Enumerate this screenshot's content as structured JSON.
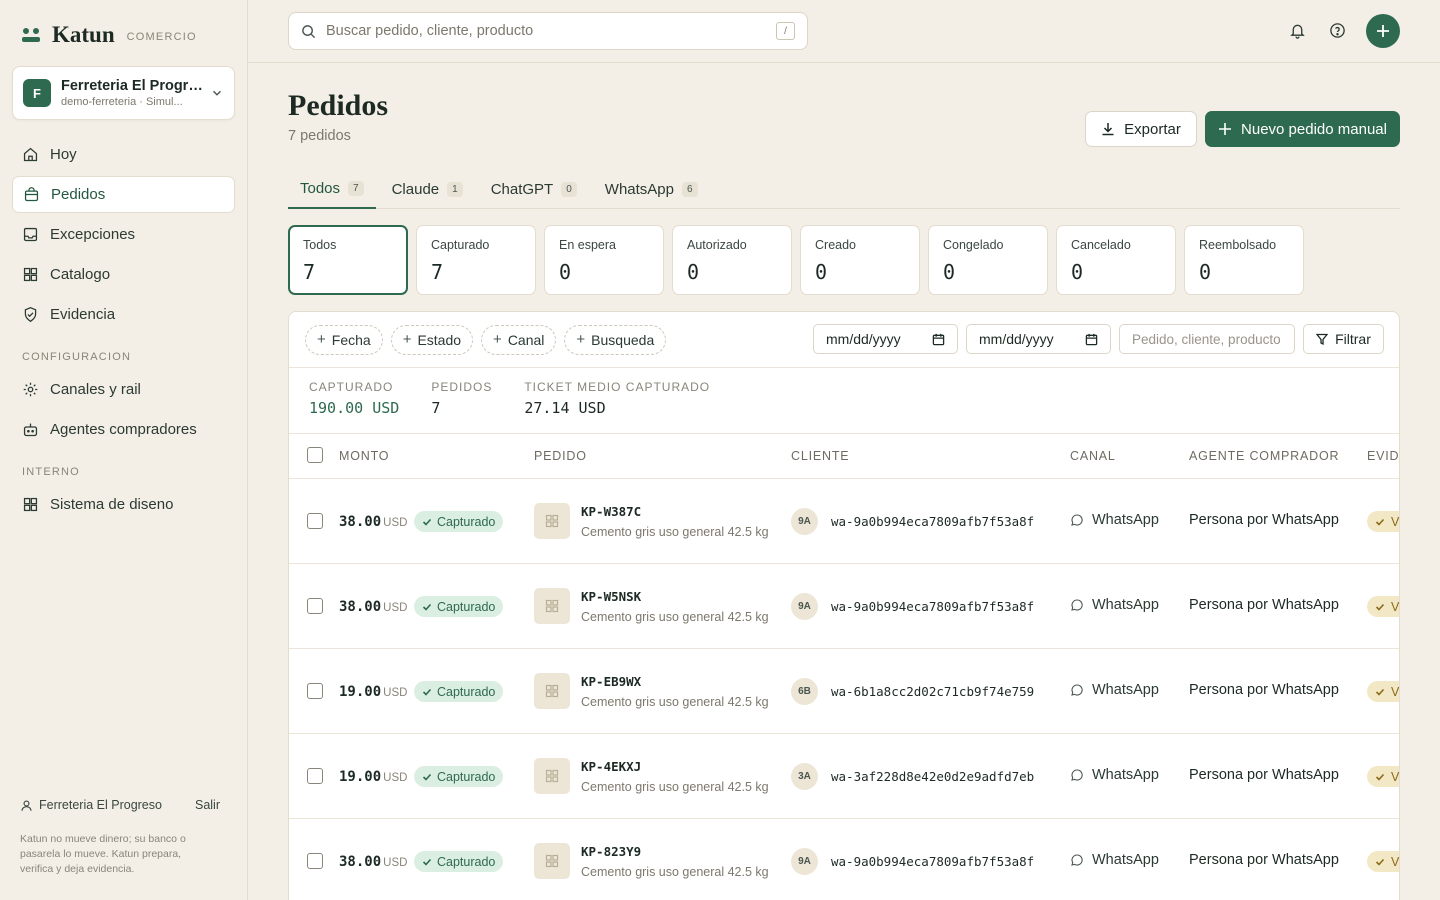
{
  "brand": {
    "name": "Katun",
    "sub": "COMERCIO"
  },
  "store": {
    "initial": "F",
    "name": "Ferreteria El Progre...",
    "meta": "demo-ferreteria · Simul..."
  },
  "nav": {
    "main": [
      {
        "label": "Hoy"
      },
      {
        "label": "Pedidos"
      },
      {
        "label": "Excepciones"
      },
      {
        "label": "Catalogo"
      },
      {
        "label": "Evidencia"
      }
    ],
    "config_title": "CONFIGURACION",
    "config": [
      {
        "label": "Canales y rail"
      },
      {
        "label": "Agentes compradores"
      }
    ],
    "internal_title": "INTERNO",
    "internal": [
      {
        "label": "Sistema de diseno"
      }
    ]
  },
  "footer": {
    "user": "Ferreteria El Progreso",
    "logout": "Salir",
    "note": "Katun no mueve dinero; su banco o pasarela lo mueve. Katun prepara, verifica y deja evidencia."
  },
  "search": {
    "placeholder": "Buscar pedido, cliente, producto",
    "shortcut": "/"
  },
  "page": {
    "title": "Pedidos",
    "count": "7 pedidos",
    "export_label": "Exportar",
    "new_label": "Nuevo pedido manual"
  },
  "tabs": [
    {
      "label": "Todos",
      "count": "7"
    },
    {
      "label": "Claude",
      "count": "1"
    },
    {
      "label": "ChatGPT",
      "count": "0"
    },
    {
      "label": "WhatsApp",
      "count": "6"
    }
  ],
  "status_cards": [
    {
      "label": "Todos",
      "value": "7"
    },
    {
      "label": "Capturado",
      "value": "7"
    },
    {
      "label": "En espera",
      "value": "0"
    },
    {
      "label": "Autorizado",
      "value": "0"
    },
    {
      "label": "Creado",
      "value": "0"
    },
    {
      "label": "Congelado",
      "value": "0"
    },
    {
      "label": "Cancelado",
      "value": "0"
    },
    {
      "label": "Reembolsado",
      "value": "0"
    }
  ],
  "filters": {
    "chips": [
      "Fecha",
      "Estado",
      "Canal",
      "Busqueda"
    ],
    "date_from": "mm/dd/yyyy",
    "date_to": "mm/dd/yyyy",
    "text_placeholder": "Pedido, cliente, producto",
    "filter_button": "Filtrar"
  },
  "metrics": [
    {
      "label": "CAPTURADO",
      "value": "190.00 USD"
    },
    {
      "label": "PEDIDOS",
      "value": "7"
    },
    {
      "label": "TICKET MEDIO CAPTURADO",
      "value": "27.14 USD"
    }
  ],
  "columns": {
    "monto": "MONTO",
    "pedido": "PEDIDO",
    "cliente": "CLIENTE",
    "canal": "CANAL",
    "agente": "AGENTE COMPRADOR",
    "evidencia": "EVIDI"
  },
  "rows": [
    {
      "amount": "38.00",
      "currency": "USD",
      "status": "Capturado",
      "order_id": "KP-W387C",
      "product": "Cemento gris uso general 42.5 kg",
      "cust_initials": "9A",
      "cust_id": "wa-9a0b994eca7809afb7f53a8f",
      "channel": "WhatsApp",
      "agent": "Persona por WhatsApp",
      "evidence": "V"
    },
    {
      "amount": "38.00",
      "currency": "USD",
      "status": "Capturado",
      "order_id": "KP-W5NSK",
      "product": "Cemento gris uso general 42.5 kg",
      "cust_initials": "9A",
      "cust_id": "wa-9a0b994eca7809afb7f53a8f",
      "channel": "WhatsApp",
      "agent": "Persona por WhatsApp",
      "evidence": "V"
    },
    {
      "amount": "19.00",
      "currency": "USD",
      "status": "Capturado",
      "order_id": "KP-EB9WX",
      "product": "Cemento gris uso general 42.5 kg",
      "cust_initials": "6B",
      "cust_id": "wa-6b1a8cc2d02c71cb9f74e759",
      "channel": "WhatsApp",
      "agent": "Persona por WhatsApp",
      "evidence": "V"
    },
    {
      "amount": "19.00",
      "currency": "USD",
      "status": "Capturado",
      "order_id": "KP-4EKXJ",
      "product": "Cemento gris uso general 42.5 kg",
      "cust_initials": "3A",
      "cust_id": "wa-3af228d8e42e0d2e9adfd7eb",
      "channel": "WhatsApp",
      "agent": "Persona por WhatsApp",
      "evidence": "V"
    },
    {
      "amount": "38.00",
      "currency": "USD",
      "status": "Capturado",
      "order_id": "KP-823Y9",
      "product": "Cemento gris uso general 42.5 kg",
      "cust_initials": "9A",
      "cust_id": "wa-9a0b994eca7809afb7f53a8f",
      "channel": "WhatsApp",
      "agent": "Persona por WhatsApp",
      "evidence": "V"
    }
  ],
  "colors": {
    "accent": "#2e6a4f",
    "background": "#f3efe6",
    "captured_badge": "#dbeee2",
    "evidence_badge": "#f3e8c6"
  }
}
